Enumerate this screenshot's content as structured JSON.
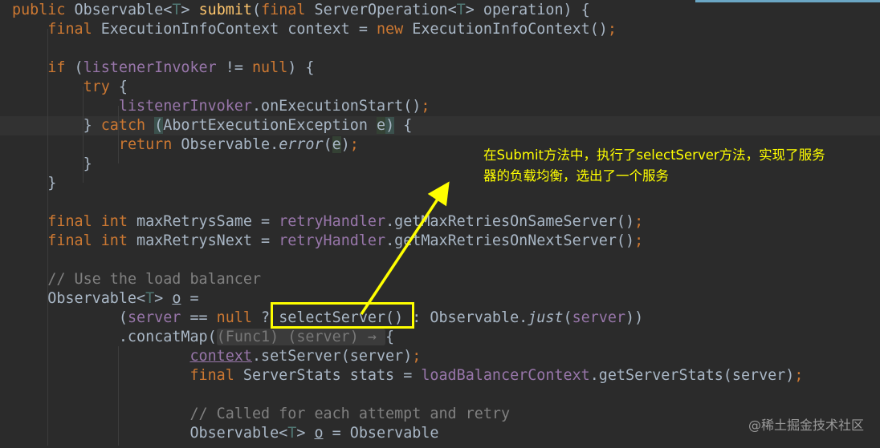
{
  "code": {
    "lines": [
      [
        {
          "t": "public ",
          "c": "kw"
        },
        {
          "t": "Observable"
        },
        {
          "t": "<",
          "c": ""
        },
        {
          "t": "T",
          "c": "tp"
        },
        {
          "t": "> "
        },
        {
          "t": "submit",
          "c": "fn"
        },
        {
          "t": "("
        },
        {
          "t": "final ",
          "c": "kw"
        },
        {
          "t": "ServerOperation<"
        },
        {
          "t": "T",
          "c": "tp"
        },
        {
          "t": "> operation) {"
        }
      ],
      [
        {
          "t": "    "
        },
        {
          "t": "final ",
          "c": "kw"
        },
        {
          "t": "ExecutionInfoContext context = "
        },
        {
          "t": "new ",
          "c": "kw"
        },
        {
          "t": "ExecutionInfoContext()"
        },
        {
          "t": ";",
          "c": "kw"
        }
      ],
      [],
      [
        {
          "t": "    "
        },
        {
          "t": "if ",
          "c": "kw"
        },
        {
          "t": "("
        },
        {
          "t": "listenerInvoker",
          "c": "fld"
        },
        {
          "t": " != "
        },
        {
          "t": "null",
          "c": "kw"
        },
        {
          "t": ") {"
        }
      ],
      [
        {
          "t": "        "
        },
        {
          "t": "try ",
          "c": "kw"
        },
        {
          "t": "{"
        }
      ],
      [
        {
          "t": "            "
        },
        {
          "t": "listenerInvoker",
          "c": "fld"
        },
        {
          "t": ".onExecutionStart()"
        },
        {
          "t": ";",
          "c": "kw"
        }
      ],
      [
        {
          "t": "        } "
        },
        {
          "t": "catch ",
          "c": "kw"
        },
        {
          "t": "(",
          "c": "brace"
        },
        {
          "t": "AbortExecutionException "
        },
        {
          "t": "e",
          "c": "param"
        },
        {
          "t": ")",
          "c": "brace"
        },
        {
          "t": " {"
        }
      ],
      [
        {
          "t": "            "
        },
        {
          "t": "return ",
          "c": "kw"
        },
        {
          "t": "Observable."
        },
        {
          "t": "error",
          "c": "it"
        },
        {
          "t": "("
        },
        {
          "t": "e",
          "c": "param"
        },
        {
          "t": ")"
        },
        {
          "t": ";",
          "c": "kw"
        }
      ],
      [
        {
          "t": "        }"
        }
      ],
      [
        {
          "t": "    }"
        }
      ],
      [],
      [
        {
          "t": "    "
        },
        {
          "t": "final ",
          "c": "kw"
        },
        {
          "t": "int ",
          "c": "kw"
        },
        {
          "t": "maxRetrysSame = "
        },
        {
          "t": "retryHandler",
          "c": "fld"
        },
        {
          "t": ".getMaxRetriesOnSameServer()"
        },
        {
          "t": ";",
          "c": "kw"
        }
      ],
      [
        {
          "t": "    "
        },
        {
          "t": "final ",
          "c": "kw"
        },
        {
          "t": "int ",
          "c": "kw"
        },
        {
          "t": "maxRetrysNext = "
        },
        {
          "t": "retryHandler",
          "c": "fld"
        },
        {
          "t": ".getMaxRetriesOnNextServer()"
        },
        {
          "t": ";",
          "c": "kw"
        }
      ],
      [],
      [
        {
          "t": "    "
        },
        {
          "t": "// Use the load balancer",
          "c": "cmt"
        }
      ],
      [
        {
          "t": "    Observable<"
        },
        {
          "t": "T",
          "c": "tp"
        },
        {
          "t": "> "
        },
        {
          "t": "o",
          "c": "under"
        },
        {
          "t": " ="
        }
      ],
      [
        {
          "t": "            ("
        },
        {
          "t": "server",
          "c": "fld"
        },
        {
          "t": " == "
        },
        {
          "t": "null ",
          "c": "kw"
        },
        {
          "t": "? selectServer() : Observable."
        },
        {
          "t": "just",
          "c": "it"
        },
        {
          "t": "("
        },
        {
          "t": "server",
          "c": "fld"
        },
        {
          "t": "))"
        }
      ],
      [
        {
          "t": "            .concatMap("
        },
        {
          "t": "(Func1) (server) → ",
          "c": "hint"
        },
        {
          "t": "{"
        }
      ],
      [
        {
          "t": "                    "
        },
        {
          "t": "context",
          "c": "fld under"
        },
        {
          "t": ".setServer(server)"
        },
        {
          "t": ";",
          "c": "kw"
        }
      ],
      [
        {
          "t": "                    "
        },
        {
          "t": "final ",
          "c": "kw"
        },
        {
          "t": "ServerStats stats = "
        },
        {
          "t": "loadBalancerContext",
          "c": "fld"
        },
        {
          "t": ".getServerStats(server)"
        },
        {
          "t": ";",
          "c": "kw"
        }
      ],
      [],
      [
        {
          "t": "                    "
        },
        {
          "t": "// Called for each attempt and retry",
          "c": "cmt"
        }
      ],
      [
        {
          "t": "                    Observable<"
        },
        {
          "t": "T",
          "c": "tp"
        },
        {
          "t": "> "
        },
        {
          "t": "o",
          "c": "under"
        },
        {
          "t": " = Observable"
        }
      ]
    ]
  },
  "annotation": {
    "text": "在Submit方法中，执行了selectServer方法，实现了服务\n器的负载均衡，选出了一个服务"
  },
  "watermark": "@稀土掘金技术社区",
  "colors": {
    "background": "#2b2b2b",
    "keyword": "#cc7832",
    "method": "#ffc66d",
    "field": "#9876aa",
    "comment": "#808080",
    "annotation": "#ffff00"
  }
}
